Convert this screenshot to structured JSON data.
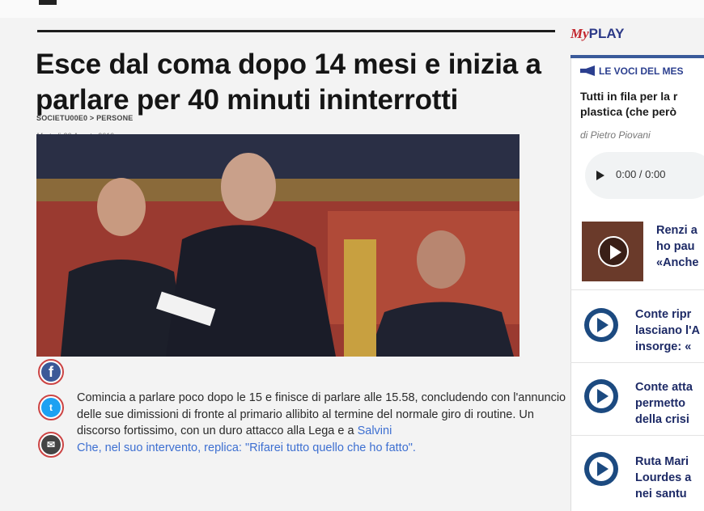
{
  "article": {
    "headline": "Esce dal coma dopo 14 mesi e inizia a parlare per 40 minuti ininterrotti",
    "breadcrumb": "SOCIETU00E0 > PERSONE",
    "date": "Martedì 20 Agosto 2019",
    "body_main": "Comincia a parlare poco dopo le 15 e finisce di parlare alle 15.58, concludendo con l'annuncio delle sue dimissioni di fronte al primario allibito al termine del normale giro di routine. Un discorso fortissimo, con un duro attacco alla Lega e a ",
    "body_link": "Salvini",
    "body_tail": "Che, nel suo intervento, replica: \"Rifarei tutto quello che ho fatto\"."
  },
  "share": {
    "facebook_glyph": "f",
    "twitter_glyph": "t",
    "mail_glyph": "✉"
  },
  "sidebar": {
    "logo_my": "My",
    "logo_play": "PLAY",
    "section_label": "LE VOCI DEL MES",
    "featured_title_line1": "Tutti in fila per la r",
    "featured_title_line2": "plastica (che però",
    "featured_author": "di Pietro Piovani",
    "audio_time": "0:00 / 0:00",
    "video_item_line1": "Renzi a",
    "video_item_line2": "ho pau",
    "video_item_line3": "«Anche",
    "items": [
      {
        "line1": "Conte ripr",
        "line2": "lasciano l'A",
        "line3": "insorge: «"
      },
      {
        "line1": "Conte atta",
        "line2": "permetto",
        "line3": "della crisi"
      },
      {
        "line1": "Ruta Mari",
        "line2": "Lourdes a",
        "line3": "nei santu"
      }
    ]
  }
}
